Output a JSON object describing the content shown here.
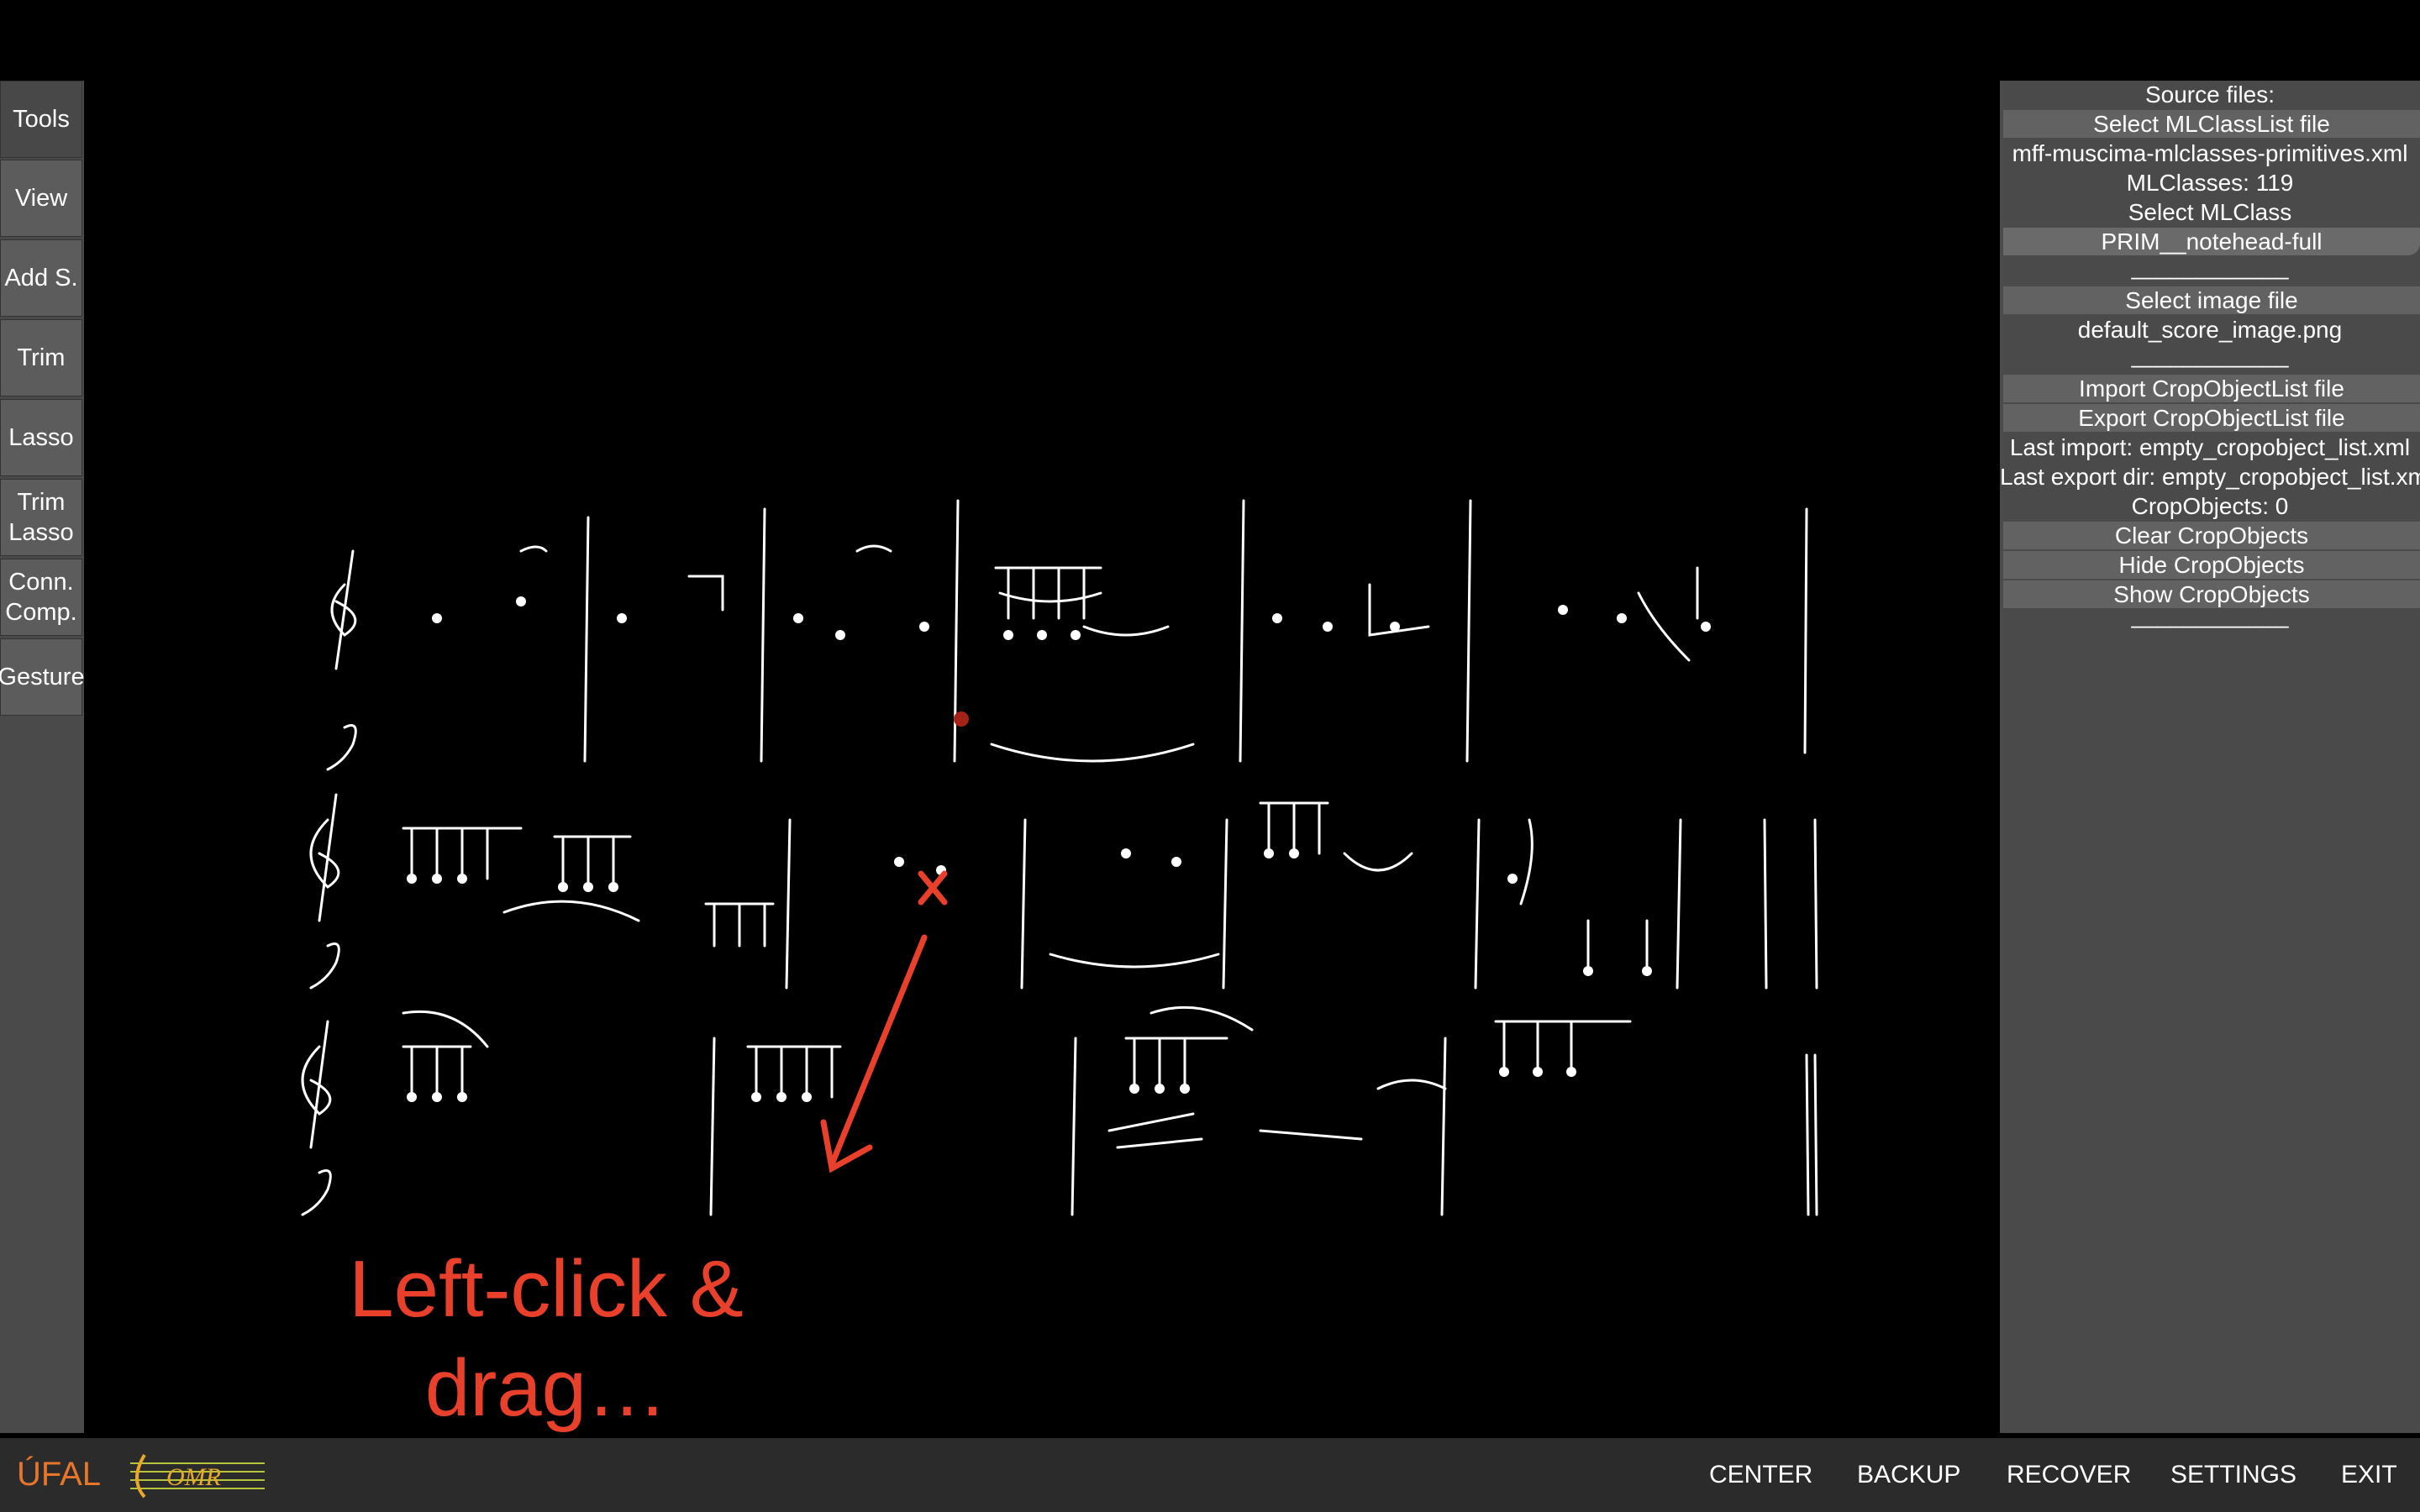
{
  "toolbar": {
    "tools": [
      {
        "label": "Tools"
      },
      {
        "label": "View"
      },
      {
        "label": "Add S."
      },
      {
        "label": "Trim"
      },
      {
        "label": "Lasso"
      },
      {
        "label": "Trim\nLasso"
      },
      {
        "label": "Conn.\nComp."
      },
      {
        "label": "Gesture"
      }
    ]
  },
  "canvas": {
    "instruction": "Left-click &\ndrag…",
    "image": "default_score_image.png",
    "annotation_color": "#e8402a"
  },
  "panel": {
    "source_files_label": "Source files:",
    "select_mlclasslist": "Select MLClassList file",
    "mlclasslist_file": "mff-muscima-mlclasses-primitives.xml",
    "mlclasses_count": "MLClasses: 119",
    "select_mlclass": "Select MLClass",
    "current_mlclass": "PRIM__notehead-full",
    "divider": "____________",
    "select_image": "Select image file",
    "image_file": "default_score_image.png",
    "import_cropobjects": "Import CropObjectList file",
    "export_cropobjects": "Export CropObjectList file",
    "last_import": "Last import: empty_cropobject_list.xml",
    "last_export": "Last export dir: empty_cropobject_list.xml",
    "cropobjects_count": "CropObjects: 0",
    "clear_cropobjects": "Clear CropObjects",
    "hide_cropobjects": "Hide CropObjects",
    "show_cropobjects": "Show CropObjects"
  },
  "bottom": {
    "logo_ufal": "ÚFAL",
    "logo_omr": "OMR",
    "center": "CENTER",
    "backup": "BACKUP",
    "recover": "RECOVER",
    "settings": "SETTINGS",
    "exit": "EXIT"
  }
}
